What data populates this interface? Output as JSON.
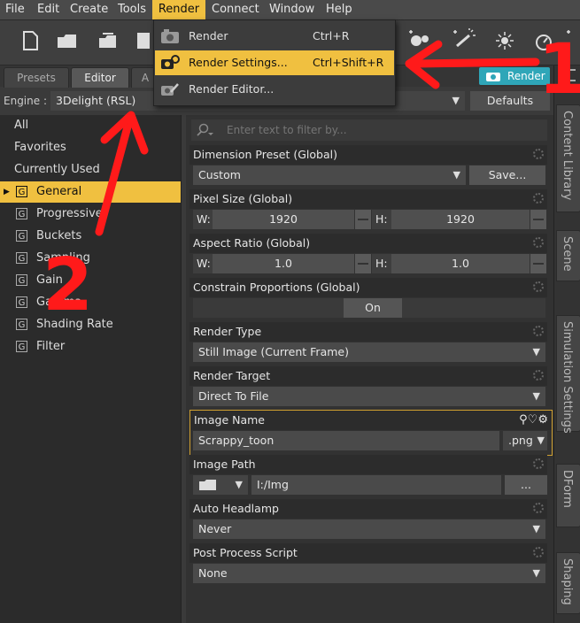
{
  "menubar": {
    "items": [
      "File",
      "Edit",
      "Create",
      "Tools",
      "Render",
      "Connect",
      "Window",
      "Help"
    ]
  },
  "render_menu": {
    "items": [
      {
        "label": "Render",
        "shortcut": "Ctrl+R"
      },
      {
        "label": "Render Settings...",
        "shortcut": "Ctrl+Shift+R"
      },
      {
        "label": "Render Editor...",
        "shortcut": ""
      }
    ]
  },
  "tabs": {
    "presets": "Presets",
    "editor": "Editor",
    "advanced_stub": "A"
  },
  "render_button": "Render",
  "engine": {
    "label": "Engine :",
    "value": "3Delight (RSL)",
    "defaults": "Defaults"
  },
  "filter": {
    "placeholder": "Enter text to filter by..."
  },
  "left_panel": {
    "items": [
      "All",
      "Favorites",
      "Currently Used",
      "General",
      "Progressive",
      "Buckets",
      "Sampling",
      "Gain",
      "Gamma",
      "Shading Rate",
      "Filter"
    ]
  },
  "properties": {
    "dimension_preset": {
      "label": "Dimension Preset (Global)",
      "value": "Custom",
      "save": "Save..."
    },
    "pixel_size": {
      "label": "Pixel Size (Global)",
      "w_label": "W:",
      "w_value": "1920",
      "h_label": "H:",
      "h_value": "1920"
    },
    "aspect_ratio": {
      "label": "Aspect Ratio (Global)",
      "w_label": "W:",
      "w_value": "1.0",
      "h_label": "H:",
      "h_value": "1.0"
    },
    "constrain": {
      "label": "Constrain Proportions (Global)",
      "value": "On"
    },
    "render_type": {
      "label": "Render Type",
      "value": "Still Image (Current Frame)"
    },
    "render_target": {
      "label": "Render Target",
      "value": "Direct To File"
    },
    "image_name": {
      "label": "Image Name",
      "value": "Scrappy_toon",
      "ext": ".png"
    },
    "image_path": {
      "label": "Image Path",
      "value": "I:/Img",
      "browse": "..."
    },
    "auto_headlamp": {
      "label": "Auto Headlamp",
      "value": "Never"
    },
    "post_process": {
      "label": "Post Process Script",
      "value": "None"
    }
  },
  "vertical_tabs": [
    "Content Library",
    "Scene",
    "Simulation Settings",
    "DForm",
    "Shaping"
  ],
  "annotations": {
    "one": "1",
    "two": "2"
  },
  "colors": {
    "accent": "#f0c040",
    "render_button": "#2fa6b8",
    "annotation": "#ff1a1a"
  }
}
